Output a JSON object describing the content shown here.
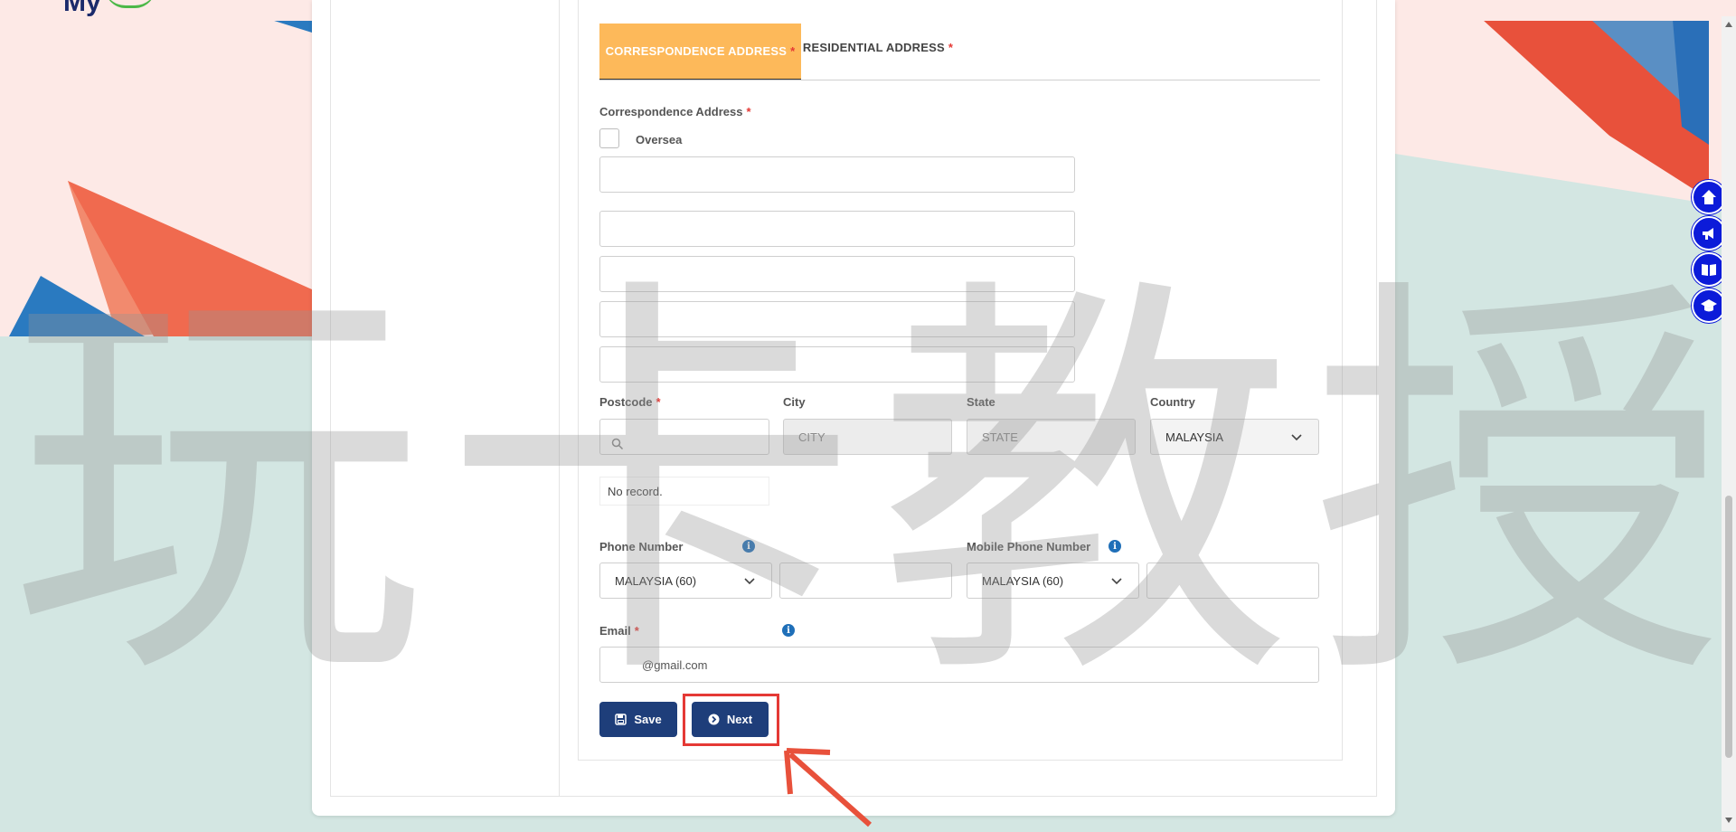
{
  "tabs": [
    {
      "label": "CORRESPONDENCE ADDRESS",
      "required": "*",
      "active": true
    },
    {
      "label": "RESIDENTIAL ADDRESS",
      "required": "*",
      "active": false
    }
  ],
  "form": {
    "correspondence_label": "Correspondence Address",
    "required_mark": "*",
    "oversea_label": "Oversea",
    "postcode_label": "Postcode",
    "city_label": "City",
    "city_placeholder": "CITY",
    "state_label": "State",
    "state_placeholder": "STATE",
    "country_label": "Country",
    "country_value": "MALAYSIA",
    "no_record": "No record.",
    "phone_label": "Phone Number",
    "phone_country": "MALAYSIA (60)",
    "mobile_label": "Mobile Phone Number",
    "mobile_country": "MALAYSIA (60)",
    "email_label": "Email",
    "email_value": "@gmail.com"
  },
  "buttons": {
    "save": "Save",
    "next": "Next"
  },
  "floating_icons": [
    "home-icon",
    "megaphone-icon",
    "book-icon",
    "graduation-cap-icon"
  ],
  "watermark": [
    "玩",
    "卡",
    "教",
    "授"
  ],
  "colors": {
    "tab_active": "#fdb95a",
    "button": "#1e3e7a",
    "highlight": "#e53935",
    "float_icon": "#0c1bd9"
  }
}
